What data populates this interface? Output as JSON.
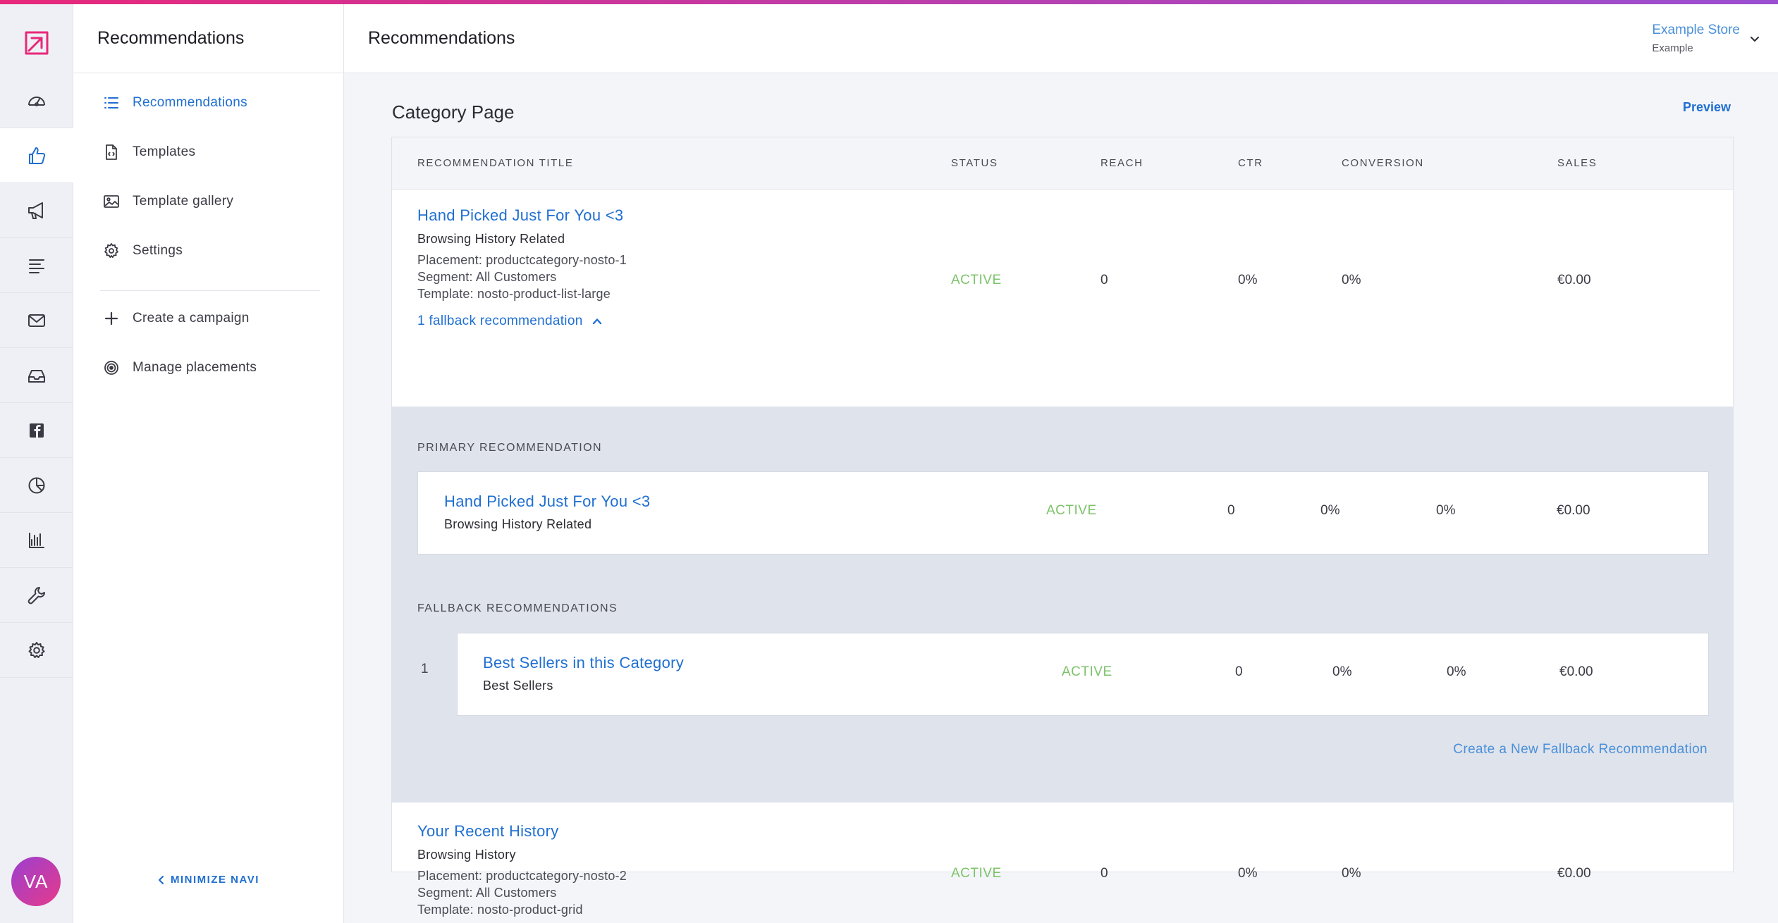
{
  "rail": {
    "items": [
      {
        "icon": "dashboard-icon"
      },
      {
        "icon": "thumbs-up-icon",
        "active": true
      },
      {
        "icon": "megaphone-icon"
      },
      {
        "icon": "content-list-icon"
      },
      {
        "icon": "email-icon"
      },
      {
        "icon": "inbox-icon"
      },
      {
        "icon": "facebook-icon"
      },
      {
        "icon": "pie-chart-icon"
      },
      {
        "icon": "bar-chart-icon"
      },
      {
        "icon": "wrench-icon"
      },
      {
        "icon": "settings-icon"
      }
    ],
    "avatar": "VA"
  },
  "subnav": {
    "title": "Recommendations",
    "items": [
      {
        "label": "Recommendations",
        "icon": "list-icon",
        "active": true
      },
      {
        "label": "Templates",
        "icon": "file-code-icon"
      },
      {
        "label": "Template gallery",
        "icon": "image-icon"
      },
      {
        "label": "Settings",
        "icon": "gear-icon"
      },
      {
        "label": "Create a campaign",
        "icon": "plus-icon"
      },
      {
        "label": "Manage placements",
        "icon": "target-icon"
      }
    ],
    "minimize": "MINIMIZE NAVI"
  },
  "header": {
    "title": "Recommendations",
    "store_name": "Example Store",
    "store_sub": "Example"
  },
  "page": {
    "heading": "Category Page",
    "preview": "Preview"
  },
  "table": {
    "columns": [
      "RECOMMENDATION TITLE",
      "STATUS",
      "REACH",
      "CTR",
      "CONVERSION",
      "SALES"
    ],
    "rows": [
      {
        "title": "Hand Picked Just For You <3",
        "type": "Browsing History Related",
        "placement": "Placement: productcategory-nosto-1",
        "segment": "Segment: All Customers",
        "template": "Template: nosto-product-list-large",
        "fallback_toggle": "1 fallback recommendation",
        "status": "ACTIVE",
        "reach": "0",
        "ctr": "0%",
        "conversion": "0%",
        "sales": "€0.00"
      },
      {
        "title": "Your Recent History",
        "type": "Browsing History",
        "placement": "Placement: productcategory-nosto-2",
        "segment": "Segment: All Customers",
        "template": "Template: nosto-product-grid",
        "status": "ACTIVE",
        "reach": "0",
        "ctr": "0%",
        "conversion": "0%",
        "sales": "€0.00"
      }
    ],
    "expanded": {
      "primary_label": "PRIMARY RECOMMENDATION",
      "primary": {
        "title": "Hand Picked Just For You <3",
        "type": "Browsing History Related",
        "status": "ACTIVE",
        "reach": "0",
        "ctr": "0%",
        "conversion": "0%",
        "sales": "€0.00"
      },
      "fallback_label": "FALLBACK RECOMMENDATIONS",
      "fallbacks": [
        {
          "index": "1",
          "title": "Best Sellers in this Category",
          "type": "Best Sellers",
          "status": "ACTIVE",
          "reach": "0",
          "ctr": "0%",
          "conversion": "0%",
          "sales": "€0.00"
        }
      ],
      "create_link": "Create a New Fallback Recommendation"
    }
  },
  "colors": {
    "accent": "#1f6fd1",
    "active_status": "#7cc36a",
    "brand_gradient_start": "#e8287a",
    "brand_gradient_end": "#9a4fd1"
  }
}
